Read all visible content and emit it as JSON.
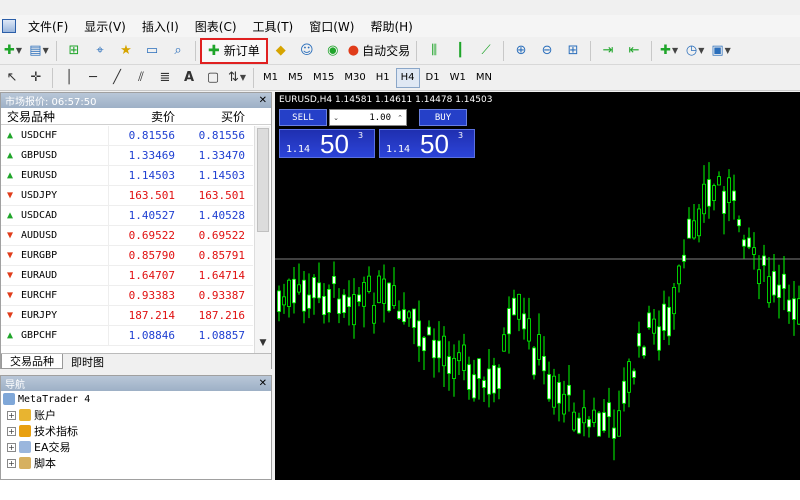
{
  "menu": [
    "文件(F)",
    "显示(V)",
    "插入(I)",
    "图表(C)",
    "工具(T)",
    "窗口(W)",
    "帮助(H)"
  ],
  "toolbar": {
    "new_order": "新订单",
    "auto_trading": "自动交易"
  },
  "timeframes": [
    "M1",
    "M5",
    "M15",
    "M30",
    "H1",
    "H4",
    "D1",
    "W1",
    "MN"
  ],
  "active_timeframe": "H4",
  "market_watch": {
    "title": "市场报价: 06:57:50",
    "col_symbol": "交易品种",
    "col_bid": "卖价",
    "col_ask": "买价",
    "rows": [
      {
        "symbol": "USDCHF",
        "bid": "0.81556",
        "ask": "0.81556",
        "dir": "up"
      },
      {
        "symbol": "GBPUSD",
        "bid": "1.33469",
        "ask": "1.33470",
        "dir": "up"
      },
      {
        "symbol": "EURUSD",
        "bid": "1.14503",
        "ask": "1.14503",
        "dir": "up"
      },
      {
        "symbol": "USDJPY",
        "bid": "163.501",
        "ask": "163.501",
        "dir": "down"
      },
      {
        "symbol": "USDCAD",
        "bid": "1.40527",
        "ask": "1.40528",
        "dir": "up"
      },
      {
        "symbol": "AUDUSD",
        "bid": "0.69522",
        "ask": "0.69522",
        "dir": "down"
      },
      {
        "symbol": "EURGBP",
        "bid": "0.85790",
        "ask": "0.85791",
        "dir": "down"
      },
      {
        "symbol": "EURAUD",
        "bid": "1.64707",
        "ask": "1.64714",
        "dir": "down"
      },
      {
        "symbol": "EURCHF",
        "bid": "0.93383",
        "ask": "0.93387",
        "dir": "down"
      },
      {
        "symbol": "EURJPY",
        "bid": "187.214",
        "ask": "187.216",
        "dir": "down"
      },
      {
        "symbol": "GBPCHF",
        "bid": "1.08846",
        "ask": "1.08857",
        "dir": "up"
      }
    ],
    "tabs": [
      "交易品种",
      "即时图"
    ]
  },
  "navigator": {
    "title": "导航",
    "root": "MetaTrader 4",
    "items": [
      "账户",
      "技术指标",
      "EA交易",
      "脚本"
    ]
  },
  "chart": {
    "title": "EURUSD,H4  1.14581 1.14611 1.14478 1.14503",
    "sell_label": "SELL",
    "buy_label": "BUY",
    "lot": "1.00",
    "bid_prefix": "1.14",
    "bid_big": "50",
    "bid_sup": "3",
    "ask_prefix": "1.14",
    "ask_big": "50",
    "ask_sup": "3",
    "colors": {
      "background": "#000000",
      "candle": "#00ff00",
      "bear_body": "#ffffff",
      "bid_line": "#808080"
    }
  }
}
